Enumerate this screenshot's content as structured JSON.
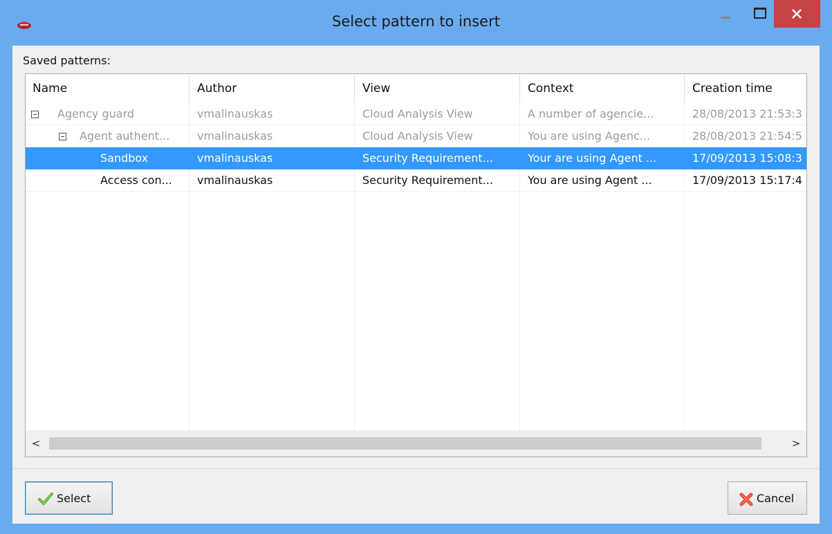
{
  "window": {
    "title": "Select pattern to insert",
    "app_icon": "red-cap-logo-icon"
  },
  "saved_label": "Saved patterns:",
  "columns": [
    "Name",
    "Author",
    "View",
    "Context",
    "Creation time"
  ],
  "rows": [
    {
      "name": "Agency guard",
      "author": "vmalinauskas",
      "view": "Cloud Analysis View",
      "context": "A number of agencie...",
      "time": "28/08/2013 21:53:3"
    },
    {
      "name": "Agent authent...",
      "author": "vmalinauskas",
      "view": "Cloud Analysis View",
      "context": "You are using Agenc...",
      "time": "28/08/2013 21:54:5"
    },
    {
      "name": "Sandbox",
      "author": "vmalinauskas",
      "view": "Security Requirement...",
      "context": "Your are using Agent ...",
      "time": "17/09/2013 15:08:3"
    },
    {
      "name": "Access con...",
      "author": "vmalinauskas",
      "view": "Security Requirement...",
      "context": "You are using Agent ...",
      "time": "17/09/2013 15:17:4"
    }
  ],
  "scrollbar": {
    "left_arrow": "<",
    "right_arrow": ">"
  },
  "buttons": {
    "select": "Select",
    "cancel": "Cancel"
  },
  "colors": {
    "titlebar": "#6aabf0",
    "close": "#c74343",
    "selection": "#3399ff"
  }
}
